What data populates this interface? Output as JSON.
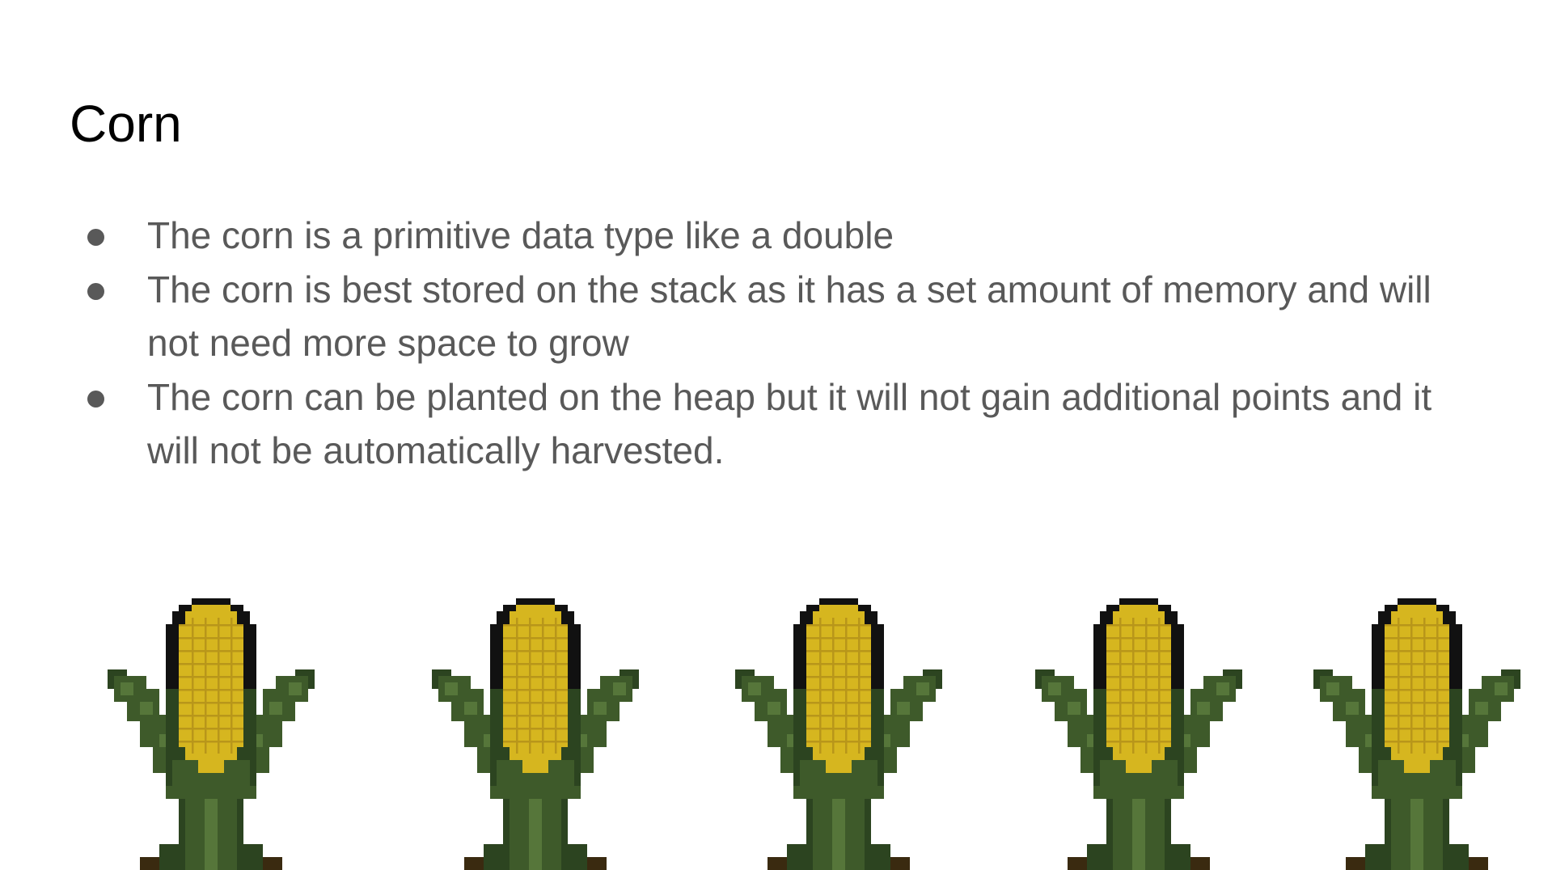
{
  "slide": {
    "title": "Corn",
    "bullets": [
      "The corn is a primitive data type like a double",
      "The corn is best stored on the stack as it has a set amount of memory and will not need more space to grow",
      "The corn can be planted on the heap but it will not gain additional points and it will not be automatically harvested."
    ]
  },
  "images": {
    "corn_count": 5,
    "icon": "corn-plant-icon"
  },
  "colors": {
    "title": "#000000",
    "body_text": "#595959",
    "background": "#ffffff",
    "corn_yellow": "#d6b61f",
    "corn_yellow_dark": "#b8961a",
    "leaf_green": "#3e5a2a",
    "leaf_green_dark": "#2c4420",
    "leaf_green_light": "#56763a",
    "outline": "#111111",
    "soil": "#3a2a10"
  }
}
